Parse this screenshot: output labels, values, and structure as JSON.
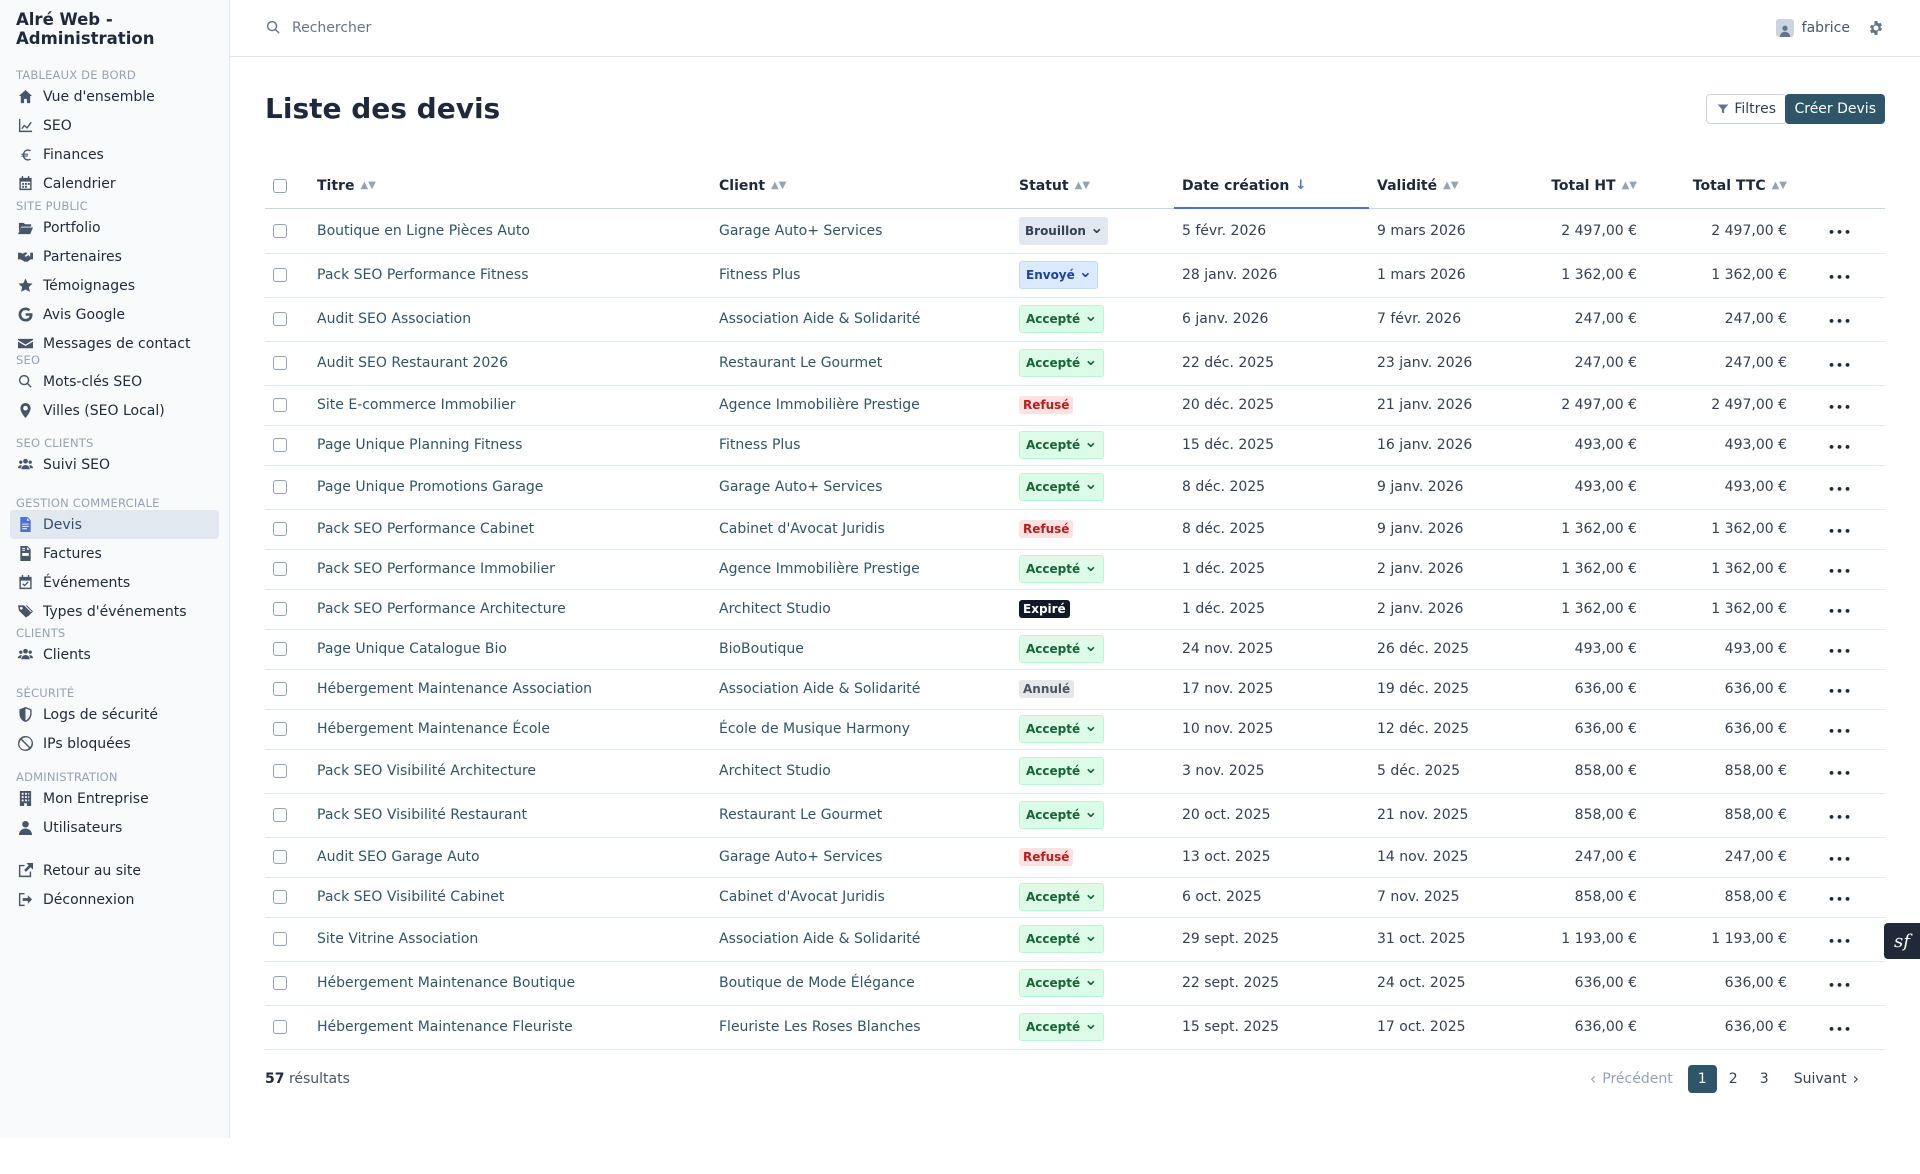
{
  "app": {
    "title": "Alré Web - Administration"
  },
  "search": {
    "placeholder": "Rechercher"
  },
  "user": {
    "name": "fabrice"
  },
  "sidebar": {
    "sections": [
      {
        "title": "Tableaux de bord",
        "items": [
          {
            "label": "Vue d'ensemble",
            "icon": "home-icon"
          },
          {
            "label": "SEO",
            "icon": "chart-line-icon"
          },
          {
            "label": "Finances",
            "icon": "euro-icon"
          },
          {
            "label": "Calendrier",
            "icon": "calendar-icon"
          }
        ]
      },
      {
        "title": "Site public",
        "items": [
          {
            "label": "Portfolio",
            "icon": "folder-open-icon"
          },
          {
            "label": "Partenaires",
            "icon": "handshake-icon"
          },
          {
            "label": "Témoignages",
            "icon": "star-icon"
          },
          {
            "label": "Avis Google",
            "icon": "google-icon"
          },
          {
            "label": "Messages de contact",
            "icon": "envelope-icon"
          }
        ]
      },
      {
        "title": "SEO",
        "items": [
          {
            "label": "Mots-clés SEO",
            "icon": "search-icon"
          },
          {
            "label": "Villes (SEO Local)",
            "icon": "map-pin-icon"
          }
        ]
      },
      {
        "title": "SEO Clients",
        "items": [
          {
            "label": "Suivi SEO",
            "icon": "users-icon"
          }
        ]
      },
      {
        "title": "Gestion commerciale",
        "items": [
          {
            "label": "Devis",
            "icon": "file-icon",
            "active": true
          },
          {
            "label": "Factures",
            "icon": "file-invoice-icon"
          },
          {
            "label": "Événements",
            "icon": "calendar-check-icon"
          },
          {
            "label": "Types d'événements",
            "icon": "tags-icon"
          }
        ]
      },
      {
        "title": "Clients",
        "items": [
          {
            "label": "Clients",
            "icon": "users-icon"
          }
        ]
      },
      {
        "title": "Sécurité",
        "items": [
          {
            "label": "Logs de sécurité",
            "icon": "shield-icon"
          },
          {
            "label": "IPs bloquées",
            "icon": "ban-icon"
          }
        ]
      },
      {
        "title": "Administration",
        "items": [
          {
            "label": "Mon Entreprise",
            "icon": "building-icon"
          },
          {
            "label": "Utilisateurs",
            "icon": "user-icon"
          }
        ]
      },
      {
        "title": "",
        "items": [
          {
            "label": "Retour au site",
            "icon": "external-link-icon"
          },
          {
            "label": "Déconnexion",
            "icon": "logout-icon"
          }
        ]
      }
    ]
  },
  "page": {
    "title": "Liste des devis",
    "filters_label": "Filtres",
    "create_label": "Créer Devis"
  },
  "table": {
    "columns": {
      "title": "Titre",
      "client": "Client",
      "status": "Statut",
      "created": "Date création",
      "validity": "Validité",
      "total_ht": "Total HT",
      "total_ttc": "Total TTC"
    },
    "rows": [
      {
        "title": "Boutique en Ligne Pièces Auto",
        "client": "Garage Auto+ Services",
        "status": "Brouillon",
        "status_kind": "draft",
        "created": "5 févr. 2026",
        "validity": "9 mars 2026",
        "ht": "2 497,00 €",
        "ttc": "2 497,00 €"
      },
      {
        "title": "Pack SEO Performance Fitness",
        "client": "Fitness Plus",
        "status": "Envoyé",
        "status_kind": "sent",
        "created": "28 janv. 2026",
        "validity": "1 mars 2026",
        "ht": "1 362,00 €",
        "ttc": "1 362,00 €"
      },
      {
        "title": "Audit SEO Association",
        "client": "Association Aide & Solidarité",
        "status": "Accepté",
        "status_kind": "accepted",
        "created": "6 janv. 2026",
        "validity": "7 févr. 2026",
        "ht": "247,00 €",
        "ttc": "247,00 €"
      },
      {
        "title": "Audit SEO Restaurant 2026",
        "client": "Restaurant Le Gourmet",
        "status": "Accepté",
        "status_kind": "accepted",
        "created": "22 déc. 2025",
        "validity": "23 janv. 2026",
        "ht": "247,00 €",
        "ttc": "247,00 €"
      },
      {
        "title": "Site E-commerce Immobilier",
        "client": "Agence Immobilière Prestige",
        "status": "Refusé",
        "status_kind": "refused",
        "created": "20 déc. 2025",
        "validity": "21 janv. 2026",
        "ht": "2 497,00 €",
        "ttc": "2 497,00 €"
      },
      {
        "title": "Page Unique Planning Fitness",
        "client": "Fitness Plus",
        "status": "Accepté",
        "status_kind": "accepted",
        "created": "15 déc. 2025",
        "validity": "16 janv. 2026",
        "ht": "493,00 €",
        "ttc": "493,00 €"
      },
      {
        "title": "Page Unique Promotions Garage",
        "client": "Garage Auto+ Services",
        "status": "Accepté",
        "status_kind": "accepted",
        "created": "8 déc. 2025",
        "validity": "9 janv. 2026",
        "ht": "493,00 €",
        "ttc": "493,00 €"
      },
      {
        "title": "Pack SEO Performance Cabinet",
        "client": "Cabinet d'Avocat Juridis",
        "status": "Refusé",
        "status_kind": "refused",
        "created": "8 déc. 2025",
        "validity": "9 janv. 2026",
        "ht": "1 362,00 €",
        "ttc": "1 362,00 €"
      },
      {
        "title": "Pack SEO Performance Immobilier",
        "client": "Agence Immobilière Prestige",
        "status": "Accepté",
        "status_kind": "accepted",
        "created": "1 déc. 2025",
        "validity": "2 janv. 2026",
        "ht": "1 362,00 €",
        "ttc": "1 362,00 €"
      },
      {
        "title": "Pack SEO Performance Architecture",
        "client": "Architect Studio",
        "status": "Expiré",
        "status_kind": "expired",
        "created": "1 déc. 2025",
        "validity": "2 janv. 2026",
        "ht": "1 362,00 €",
        "ttc": "1 362,00 €"
      },
      {
        "title": "Page Unique Catalogue Bio",
        "client": "BioBoutique",
        "status": "Accepté",
        "status_kind": "accepted",
        "created": "24 nov. 2025",
        "validity": "26 déc. 2025",
        "ht": "493,00 €",
        "ttc": "493,00 €"
      },
      {
        "title": "Hébergement Maintenance Association",
        "client": "Association Aide & Solidarité",
        "status": "Annulé",
        "status_kind": "cancelled",
        "created": "17 nov. 2025",
        "validity": "19 déc. 2025",
        "ht": "636,00 €",
        "ttc": "636,00 €"
      },
      {
        "title": "Hébergement Maintenance École",
        "client": "École de Musique Harmony",
        "status": "Accepté",
        "status_kind": "accepted",
        "created": "10 nov. 2025",
        "validity": "12 déc. 2025",
        "ht": "636,00 €",
        "ttc": "636,00 €"
      },
      {
        "title": "Pack SEO Visibilité Architecture",
        "client": "Architect Studio",
        "status": "Accepté",
        "status_kind": "accepted",
        "created": "3 nov. 2025",
        "validity": "5 déc. 2025",
        "ht": "858,00 €",
        "ttc": "858,00 €"
      },
      {
        "title": "Pack SEO Visibilité Restaurant",
        "client": "Restaurant Le Gourmet",
        "status": "Accepté",
        "status_kind": "accepted",
        "created": "20 oct. 2025",
        "validity": "21 nov. 2025",
        "ht": "858,00 €",
        "ttc": "858,00 €"
      },
      {
        "title": "Audit SEO Garage Auto",
        "client": "Garage Auto+ Services",
        "status": "Refusé",
        "status_kind": "refused",
        "created": "13 oct. 2025",
        "validity": "14 nov. 2025",
        "ht": "247,00 €",
        "ttc": "247,00 €"
      },
      {
        "title": "Pack SEO Visibilité Cabinet",
        "client": "Cabinet d'Avocat Juridis",
        "status": "Accepté",
        "status_kind": "accepted",
        "created": "6 oct. 2025",
        "validity": "7 nov. 2025",
        "ht": "858,00 €",
        "ttc": "858,00 €"
      },
      {
        "title": "Site Vitrine Association",
        "client": "Association Aide & Solidarité",
        "status": "Accepté",
        "status_kind": "accepted",
        "created": "29 sept. 2025",
        "validity": "31 oct. 2025",
        "ht": "1 193,00 €",
        "ttc": "1 193,00 €"
      },
      {
        "title": "Hébergement Maintenance Boutique",
        "client": "Boutique de Mode Élégance",
        "status": "Accepté",
        "status_kind": "accepted",
        "created": "22 sept. 2025",
        "validity": "24 oct. 2025",
        "ht": "636,00 €",
        "ttc": "636,00 €"
      },
      {
        "title": "Hébergement Maintenance Fleuriste",
        "client": "Fleuriste Les Roses Blanches",
        "status": "Accepté",
        "status_kind": "accepted",
        "created": "15 sept. 2025",
        "validity": "17 oct. 2025",
        "ht": "636,00 €",
        "ttc": "636,00 €"
      }
    ]
  },
  "footer": {
    "count": "57",
    "count_suffix": "résultats",
    "prev_label": "Précédent",
    "next_label": "Suivant",
    "pages": [
      "1",
      "2",
      "3"
    ],
    "current_page": "1"
  },
  "colors": {
    "primary": "#2f5668",
    "accent": "#4f6fd1",
    "accepted_bg": "#dcfce7",
    "refused_bg": "#fee2e2",
    "sent_bg": "#dbeafe"
  }
}
